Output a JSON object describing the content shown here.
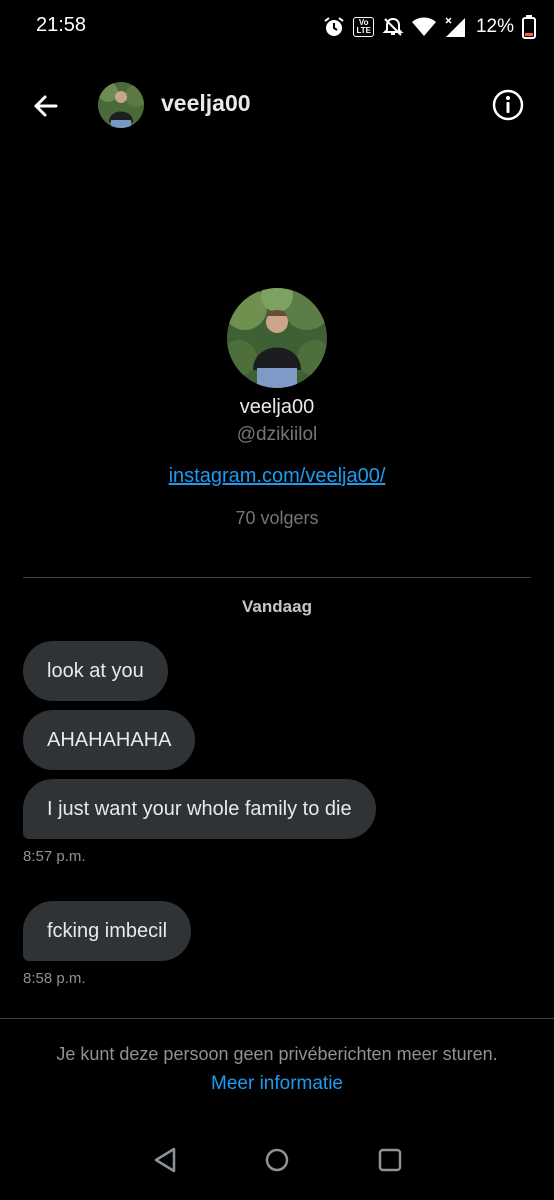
{
  "status_bar": {
    "time": "21:58",
    "volte_top": "Vo",
    "volte_bottom": "LTE",
    "battery_percent": "12%",
    "icons": [
      "alarm-icon",
      "volte-icon",
      "mute-icon",
      "wifi-icon",
      "signal-icon",
      "battery-icon"
    ]
  },
  "header": {
    "back_icon": "arrow-left-icon",
    "username": "veelja00",
    "info_icon": "info-icon"
  },
  "profile": {
    "name": "veelja00",
    "handle": "@dzikiilol",
    "link": "instagram.com/veelja00/",
    "followers": "70 volgers"
  },
  "conversation": {
    "date_separator": "Vandaag",
    "messages": [
      {
        "text": "look at you"
      },
      {
        "text": "AHAHAHAHA"
      },
      {
        "text": "I just want your whole family to die",
        "time": "8:57 p.m."
      },
      {
        "text": "fcking imbecil",
        "time": "8:58 p.m."
      }
    ]
  },
  "footer": {
    "notice": "Je kunt deze persoon geen privéberichten meer sturen.",
    "link": "Meer informatie"
  },
  "nav_bar": {
    "icons": [
      "back-triangle-icon",
      "home-circle-icon",
      "recents-square-icon"
    ]
  },
  "colors": {
    "background": "#000000",
    "bubble": "#2f3336",
    "accent": "#1d9bf0",
    "text_primary": "#e7e9ea",
    "text_secondary": "#71767b"
  }
}
